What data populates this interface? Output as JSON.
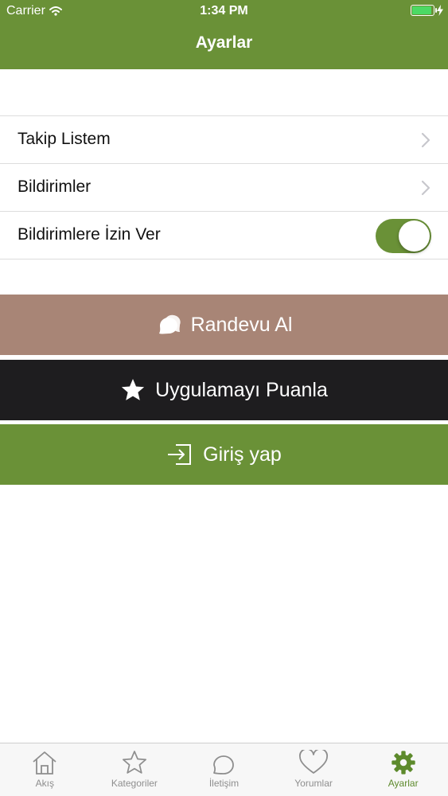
{
  "status_bar": {
    "carrier": "Carrier",
    "time": "1:34 PM",
    "battery_level": 0.85
  },
  "nav": {
    "title": "Ayarlar"
  },
  "settings": {
    "rows": [
      {
        "label": "Takip Listem"
      },
      {
        "label": "Bildirimler"
      },
      {
        "label": "Bildirimlere İzin Ver",
        "toggle_on": true
      }
    ]
  },
  "actions": {
    "randevu": {
      "label": "Randevu Al",
      "color": "#a88576"
    },
    "puanla": {
      "label": "Uygulamayı Puanla",
      "color": "#1e1d1f"
    },
    "giris": {
      "label": "Giriş yap",
      "color": "#6a9137"
    }
  },
  "tabs": [
    {
      "label": "Akış",
      "icon": "home-icon"
    },
    {
      "label": "Kategoriler",
      "icon": "star-outline-icon"
    },
    {
      "label": "İletişim",
      "icon": "chat-icon"
    },
    {
      "label": "Yorumlar",
      "icon": "heart-icon"
    },
    {
      "label": "Ayarlar",
      "icon": "gear-icon",
      "active": true
    }
  ],
  "colors": {
    "brand": "#6a9137",
    "separator": "#dddddd",
    "tab_inactive": "#8e8e8e"
  }
}
